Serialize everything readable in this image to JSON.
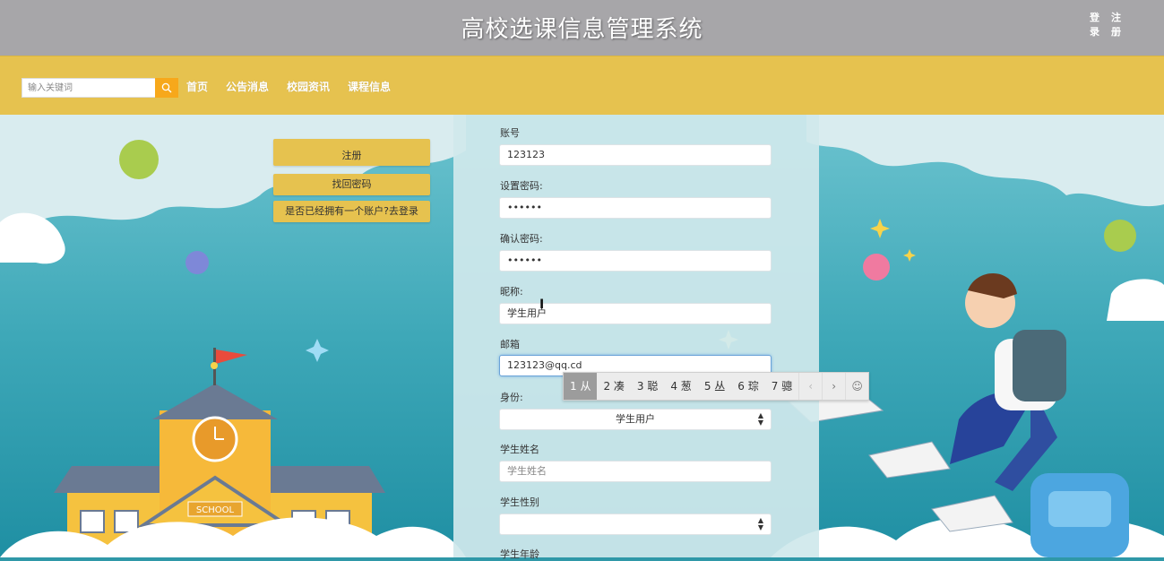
{
  "header": {
    "title": "高校选课信息管理系统",
    "auth": [
      "登",
      "注",
      "录",
      "册"
    ]
  },
  "nav": {
    "search_placeholder": "输入关键词",
    "links": [
      "首页",
      "公告消息",
      "校园资讯",
      "课程信息"
    ]
  },
  "side_buttons": {
    "register": "注册",
    "find_password": "找回密码",
    "to_login": "是否已经拥有一个账户?去登录"
  },
  "form": {
    "account_label": "账号",
    "account_value": "123123",
    "password_label": "设置密码:",
    "password_value": "••••••",
    "confirm_label": "确认密码:",
    "confirm_value": "••••••",
    "nickname_label": "昵称:",
    "nickname_value": "学生用户",
    "email_label": "邮箱",
    "email_value": "123123@qq.cd",
    "role_label": "身份:",
    "role_value": "学生用户",
    "name_label": "学生姓名",
    "name_placeholder": "学生姓名",
    "gender_label": "学生性别",
    "gender_value": "",
    "age_label": "学生年龄"
  },
  "ime": {
    "candidates": [
      "1 从",
      "2 凑",
      "3 聪",
      "4 葱",
      "5 丛",
      "6 琮",
      "7 骢"
    ],
    "prev": "‹",
    "next": "›",
    "emoji": "☺"
  },
  "scene": {
    "school_sign": "SCHOOL"
  },
  "colors": {
    "title_bar": "#a7a6a9",
    "nav_bar": "#e6c24f",
    "search_button": "#f7a81b",
    "form_panel": "#d0e8ec"
  }
}
